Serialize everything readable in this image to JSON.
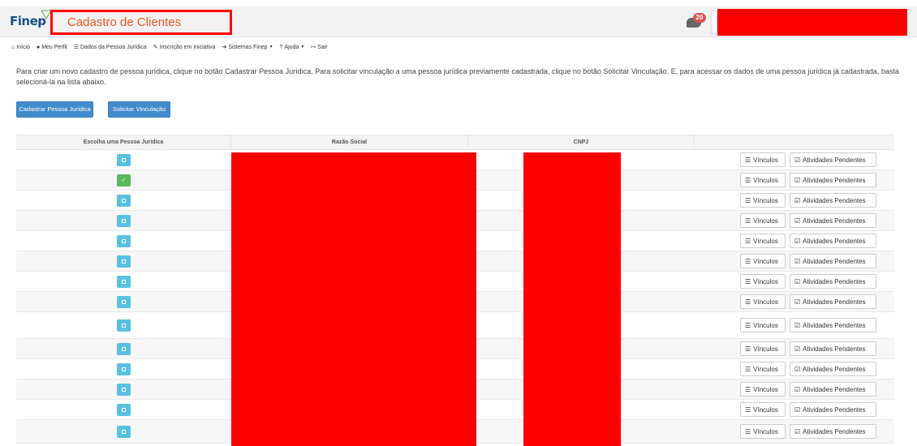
{
  "header": {
    "logo_text": "Finep",
    "title": "Cadastro de Clientes",
    "notification_count": "20"
  },
  "nav": {
    "items": [
      {
        "label": "Início",
        "icon": "home-icon"
      },
      {
        "label": "Meu Perfil",
        "icon": "user-icon"
      },
      {
        "label": "Dados da Pessoa Jurídica",
        "icon": "list-icon"
      },
      {
        "label": "Inscrição em Iniciativa",
        "icon": "pencil-icon"
      },
      {
        "label": "Sistemas Finep",
        "icon": "sign-in-icon",
        "dropdown": true
      },
      {
        "label": "Ajuda",
        "icon": "question-icon",
        "dropdown": true
      },
      {
        "label": "Sair",
        "icon": "sign-out-icon"
      }
    ]
  },
  "intro_text": "Para criar um novo cadastro de pessoa jurídica, clique no botão Cadastrar Pessoa Jurídica. Para solicitar vinculação a uma pessoa jurídica previamente cadastrada, clique no botão Solicitar Vinculação. E, para acessar os dados de uma pessoa jurídica já cadastrada, basta selecioná-la na lista abaixo.",
  "buttons": {
    "cadastrar": "Cadastrar Pessoa Jurídica",
    "solicitar": "Solicitar Vinculação"
  },
  "table": {
    "headers": [
      "Escolha uma Pessoa Jurídica",
      "Razão Social",
      "CNPJ",
      ""
    ],
    "vinculos_label": "Vínculos",
    "atividades_label": "Atividades Pendentes",
    "rows": [
      {
        "selected": false
      },
      {
        "selected": true
      },
      {
        "selected": false
      },
      {
        "selected": false
      },
      {
        "selected": false
      },
      {
        "selected": false
      },
      {
        "selected": false
      },
      {
        "selected": false
      },
      {
        "selected": false
      },
      {
        "selected": false
      },
      {
        "selected": false
      },
      {
        "selected": false
      },
      {
        "selected": false
      },
      {
        "selected": false
      }
    ]
  },
  "colors": {
    "title": "#e8571c",
    "primary_button": "#428bca",
    "select_button": "#5bc0de",
    "selected_button": "#5cb85c",
    "redaction": "#ff0000"
  }
}
